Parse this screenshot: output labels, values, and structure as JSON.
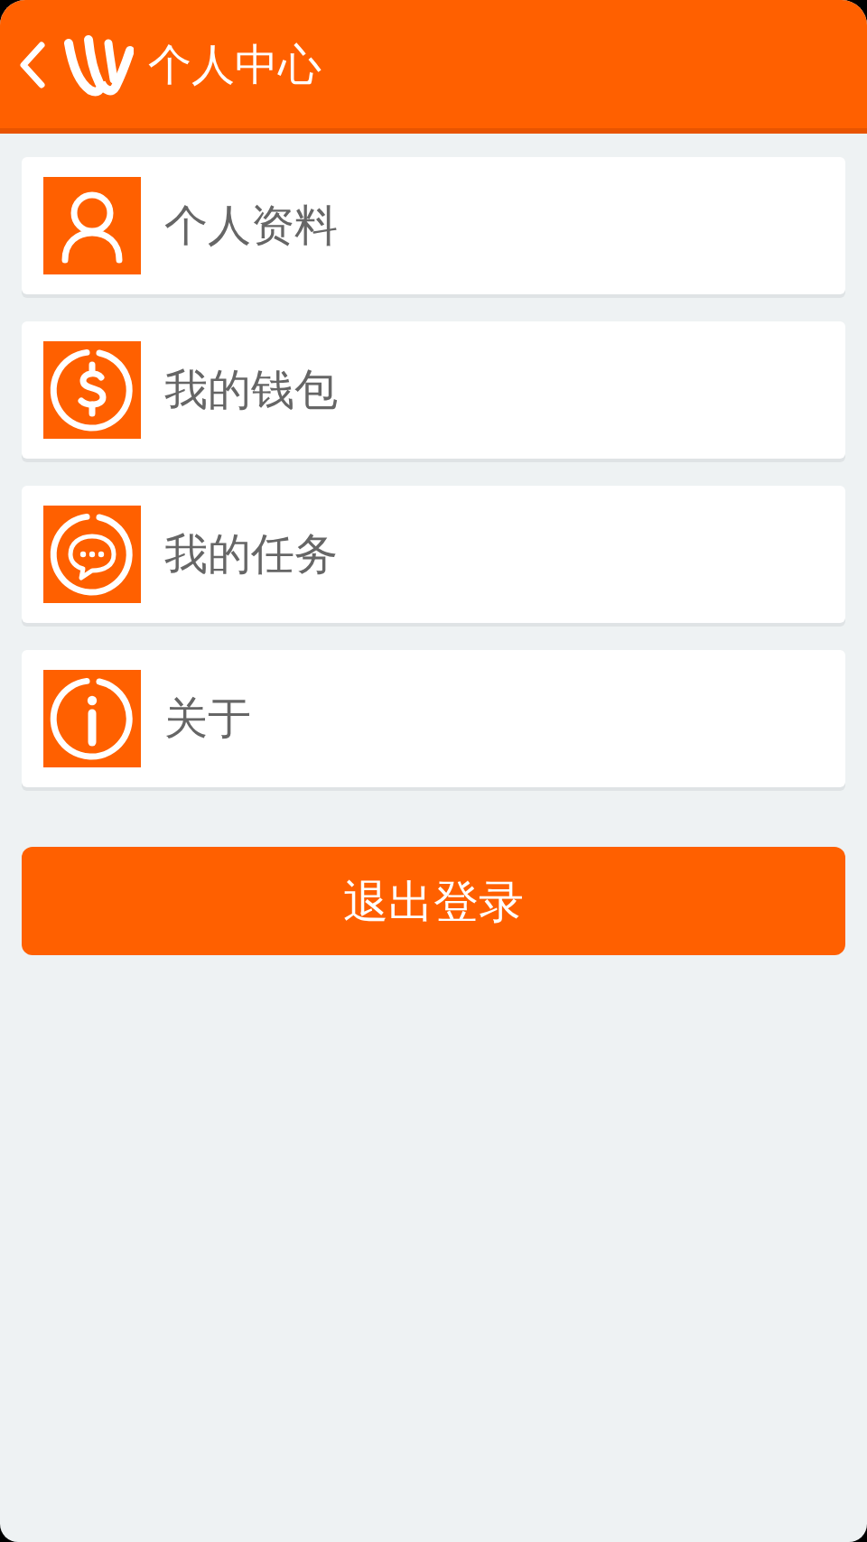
{
  "header": {
    "title": "个人中心"
  },
  "menu": [
    {
      "label": "个人资料"
    },
    {
      "label": "我的钱包"
    },
    {
      "label": "我的任务"
    },
    {
      "label": "关于"
    }
  ],
  "logout_button": "退出登录"
}
